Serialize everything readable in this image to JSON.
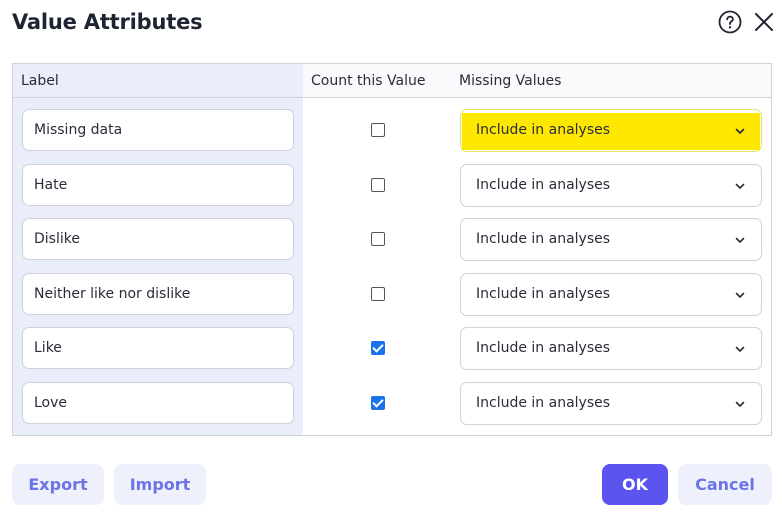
{
  "dialog": {
    "title": "Value Attributes"
  },
  "table": {
    "headers": {
      "label": "Label",
      "count": "Count this Value",
      "missing": "Missing Values"
    },
    "rows": [
      {
        "label": "Missing data",
        "count": false,
        "missing": "Include in analyses",
        "highlighted": true
      },
      {
        "label": "Hate",
        "count": false,
        "missing": "Include in analyses",
        "highlighted": false
      },
      {
        "label": "Dislike",
        "count": false,
        "missing": "Include in analyses",
        "highlighted": false
      },
      {
        "label": "Neither like nor dislike",
        "count": false,
        "missing": "Include in analyses",
        "highlighted": false
      },
      {
        "label": "Like",
        "count": true,
        "missing": "Include in analyses",
        "highlighted": false
      },
      {
        "label": "Love",
        "count": true,
        "missing": "Include in analyses",
        "highlighted": false
      }
    ]
  },
  "buttons": {
    "export": "Export",
    "import": "Import",
    "ok": "OK",
    "cancel": "Cancel"
  },
  "icons": {
    "help": "help-circle-icon",
    "close": "close-icon",
    "dropdown": "chevron-down-icon"
  },
  "colors": {
    "primary": "#5b54ee",
    "light_button_bg": "#eef0fb",
    "light_button_text": "#6b74e6",
    "label_column_bg": "#eaedfa",
    "highlight": "#ffe800",
    "checkbox_checked": "#1a73e8"
  }
}
